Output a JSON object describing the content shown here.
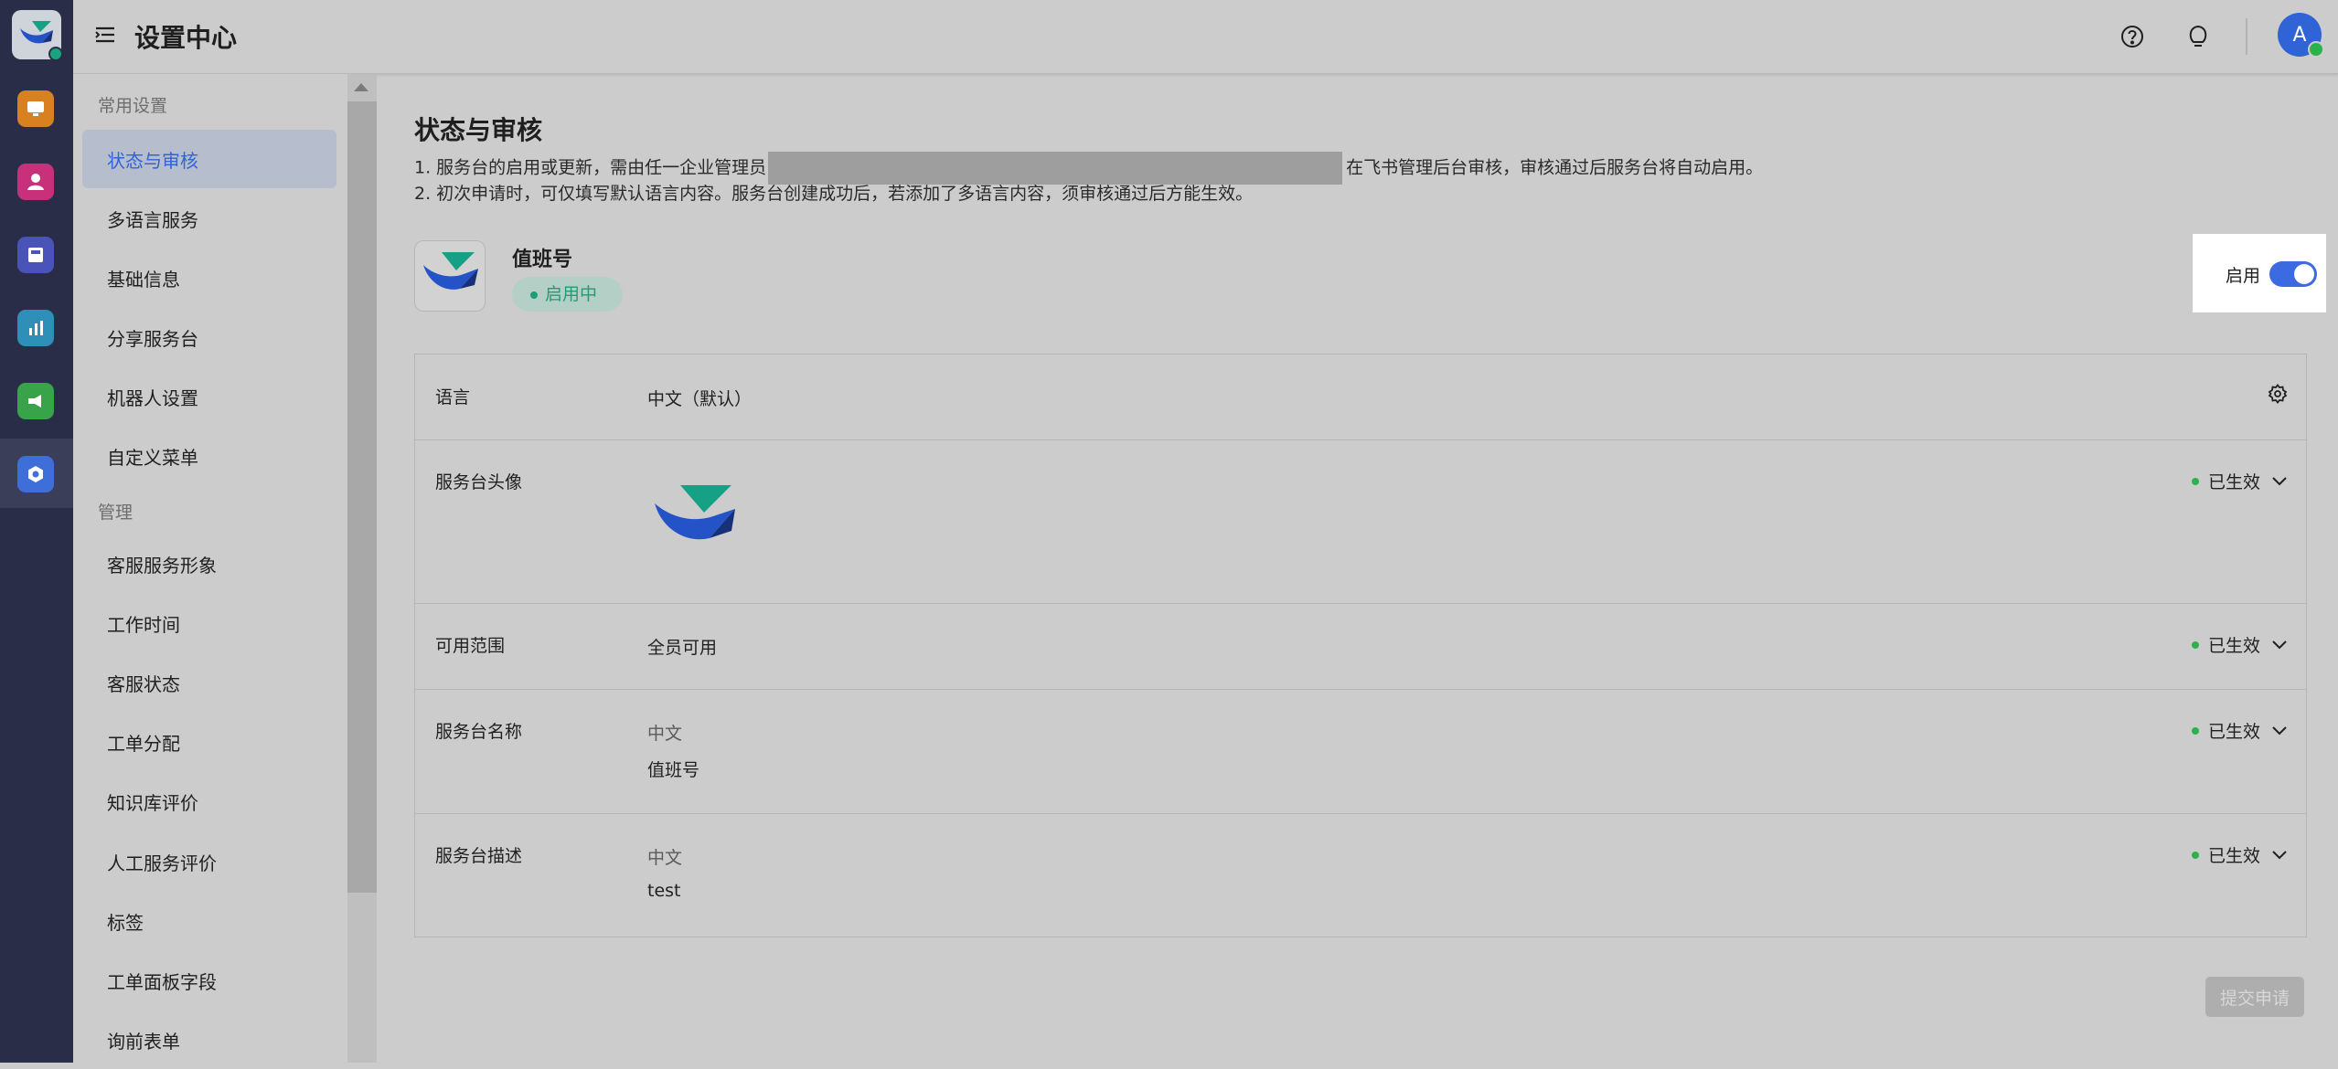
{
  "header": {
    "title": "设置中心",
    "user_initial": "A"
  },
  "sidebar": {
    "groups": [
      {
        "label": "常用设置",
        "items": [
          "状态与审核",
          "多语言服务",
          "基础信息",
          "分享服务台",
          "机器人设置",
          "自定义菜单"
        ]
      },
      {
        "label": "管理",
        "items": [
          "客服服务形象",
          "工作时间",
          "客服状态",
          "工单分配",
          "知识库评价",
          "人工服务评价",
          "标签",
          "工单面板字段",
          "询前表单"
        ]
      }
    ],
    "active_item": "状态与审核"
  },
  "main": {
    "title": "状态与审核",
    "tips": {
      "line1_prefix": "1. 服务台的启用或更新，需由任一企业管理员",
      "line1_suffix": "在飞书管理后台审核，审核通过后服务台将自动启用。",
      "line2": "2. 初次申请时，可仅填写默认语言内容。服务台创建成功后，若添加了多语言内容，须审核通过后方能生效。"
    },
    "service": {
      "name": "值班号",
      "status": "启用中"
    },
    "toggle": {
      "label": "启用",
      "on": true
    },
    "rows": {
      "language": {
        "label": "语言",
        "value": "中文（默认）"
      },
      "avatar": {
        "label": "服务台头像",
        "status": "已生效"
      },
      "scope": {
        "label": "可用范围",
        "value": "全员可用",
        "status": "已生效"
      },
      "name": {
        "label": "服务台名称",
        "lang": "中文",
        "value": "值班号",
        "status": "已生效"
      },
      "description": {
        "label": "服务台描述",
        "lang": "中文",
        "value": "test",
        "status": "已生效"
      }
    },
    "submit_label": "提交申请"
  },
  "colors": {
    "accent": "#3164d8",
    "rail": "#2a2d48",
    "status_green": "#2bb24c",
    "teal": "#1e9d76"
  },
  "icons": {
    "rail": [
      "app-logo-icon",
      "workbench-icon",
      "agent-icon",
      "ticket-icon",
      "stats-icon",
      "broadcast-icon",
      "settings-icon"
    ],
    "top": [
      "menu-icon",
      "help-icon",
      "idea-bulb-icon"
    ]
  }
}
